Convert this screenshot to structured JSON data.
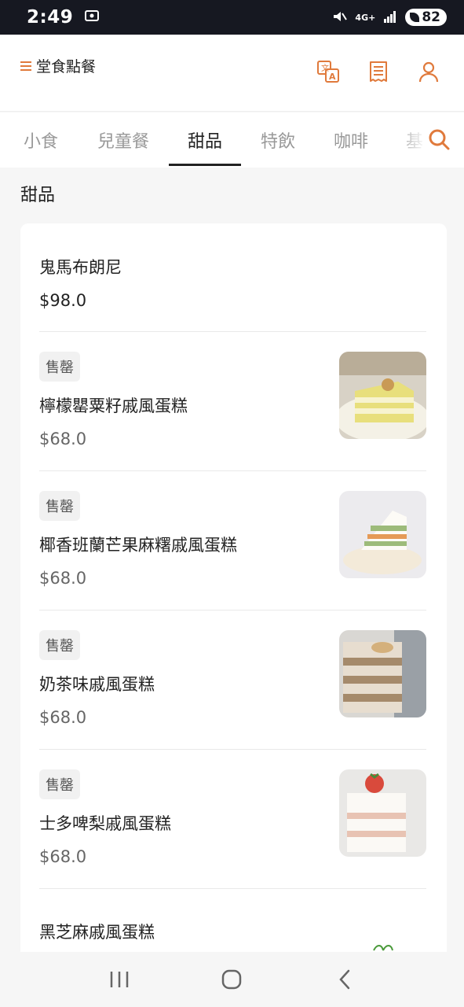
{
  "status_bar": {
    "time": "2:49",
    "network": "4G+",
    "battery": "82"
  },
  "header": {
    "menu_label": "堂食點餐",
    "icons": [
      "translate-icon",
      "receipt-icon",
      "user-icon"
    ]
  },
  "tabs": [
    {
      "label": "小食",
      "active": false
    },
    {
      "label": "兒童餐",
      "active": false
    },
    {
      "label": "甜品",
      "active": true
    },
    {
      "label": "特飲",
      "active": false
    },
    {
      "label": "咖啡",
      "active": false
    },
    {
      "label": "基",
      "active": false
    }
  ],
  "section": {
    "title": "甜品"
  },
  "items": [
    {
      "name": "鬼馬布朗尼",
      "price": "$98.0",
      "sold_out": false
    },
    {
      "name": "檸檬罌粟籽戚風蛋糕",
      "price": "$68.0",
      "sold_out": true,
      "badge": "售罄"
    },
    {
      "name": "椰香班蘭芒果麻糬戚風蛋糕",
      "price": "$68.0",
      "sold_out": true,
      "badge": "售罄"
    },
    {
      "name": "奶茶味戚風蛋糕",
      "price": "$68.0",
      "sold_out": true,
      "badge": "售罄"
    },
    {
      "name": "士多啤梨戚風蛋糕",
      "price": "$68.0",
      "sold_out": true,
      "badge": "售罄"
    },
    {
      "name": "黑芝麻戚風蛋糕",
      "price": "",
      "sold_out": false
    }
  ],
  "colors": {
    "accent": "#e07a3c",
    "status_bar": "#161821"
  }
}
